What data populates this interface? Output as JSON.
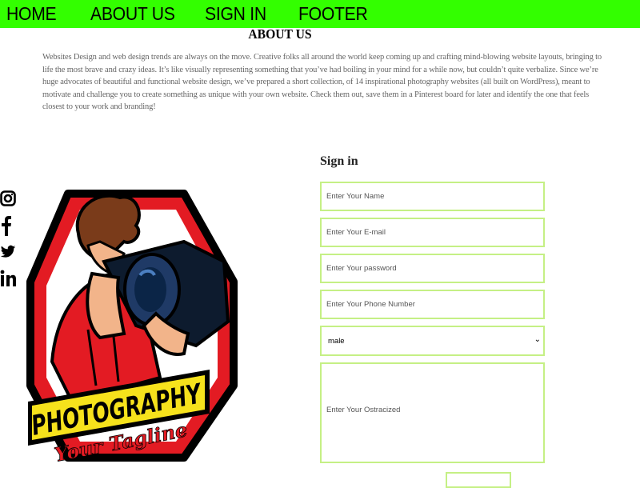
{
  "nav": {
    "items": [
      "HOME",
      "ABOUT US",
      "SIGN IN",
      "FOOTER"
    ]
  },
  "about": {
    "title": "ABOUT US",
    "text": "Websites Design and web design trends are always on the move. Creative folks all around the world keep coming up and crafting mind-blowing website layouts, bringing to life the most brave and crazy ideas. It’s like visually representing something that you’ve had boiling in your mind for a while now, but couldn’t quite verbalize. Since we’re huge advocates of beautiful and functional website design, we’ve prepared a short collection, of 14 inspirational photography websites (all built on WordPress), meant to motivate and challenge you to create something as unique with your own website. Check them out, save them in a Pinterest board for later and identify the one that feels closest to your work and branding!"
  },
  "social": {
    "icons": [
      "instagram-icon",
      "facebook-icon",
      "twitter-icon",
      "linkedin-icon"
    ]
  },
  "logo": {
    "line1": "PHOTOGRAPHY",
    "line2": "Your Tagline"
  },
  "signin": {
    "title": "Sign in",
    "name_placeholder": "Enter Your Name",
    "email_placeholder": "Enter Your E-mail",
    "password_placeholder": "Enter Your password",
    "phone_placeholder": "Enter Your Phone Number",
    "gender_selected": "male",
    "message_placeholder": "Enter Your Ostracized"
  },
  "colors": {
    "nav_bg": "#33ff00",
    "field_border": "#c5f085",
    "logo_red": "#e31b23",
    "logo_yellow": "#f6e21c"
  }
}
